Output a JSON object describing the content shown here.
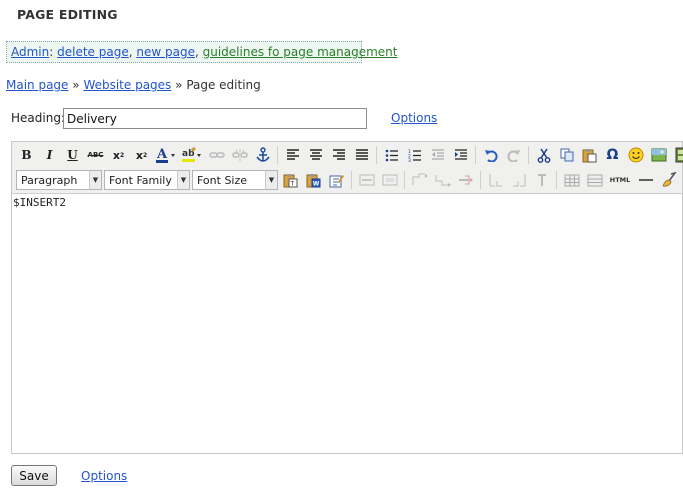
{
  "page": {
    "title": "PAGE EDITING"
  },
  "admin_bar": {
    "admin_label": "Admin",
    "separator": ":",
    "links": [
      "delete page",
      "new page",
      "guidelines fo page management"
    ],
    "comma": ","
  },
  "breadcrumb": {
    "items": [
      "Main page",
      "Website pages"
    ],
    "current": "Page editing",
    "separator": "»"
  },
  "heading": {
    "label": "Heading:",
    "value": "Delivery",
    "options_label": "Options"
  },
  "toolbar": {
    "row1_icons": [
      "bold-icon",
      "italic-icon",
      "underline-icon",
      "strikethrough-icon",
      "subscript-icon",
      "superscript-icon",
      "text-color-icon",
      "highlight-color-icon",
      "link-icon",
      "unlink-icon",
      "anchor-icon",
      "align-left-icon",
      "align-center-icon",
      "align-right-icon",
      "align-justify-icon",
      "bullet-list-icon",
      "numbered-list-icon",
      "outdent-icon",
      "indent-icon",
      "undo-icon",
      "redo-icon",
      "cut-icon",
      "copy-icon",
      "paste-icon",
      "special-char-icon",
      "emoticon-icon",
      "image-icon",
      "media-icon"
    ],
    "format_select": "Paragraph",
    "font_family_select": "Font Family",
    "font_size_select": "Font Size",
    "html_label": "HTML"
  },
  "editor": {
    "content": "$INSERT2"
  },
  "footer": {
    "save_label": "Save",
    "options_label": "Options"
  }
}
